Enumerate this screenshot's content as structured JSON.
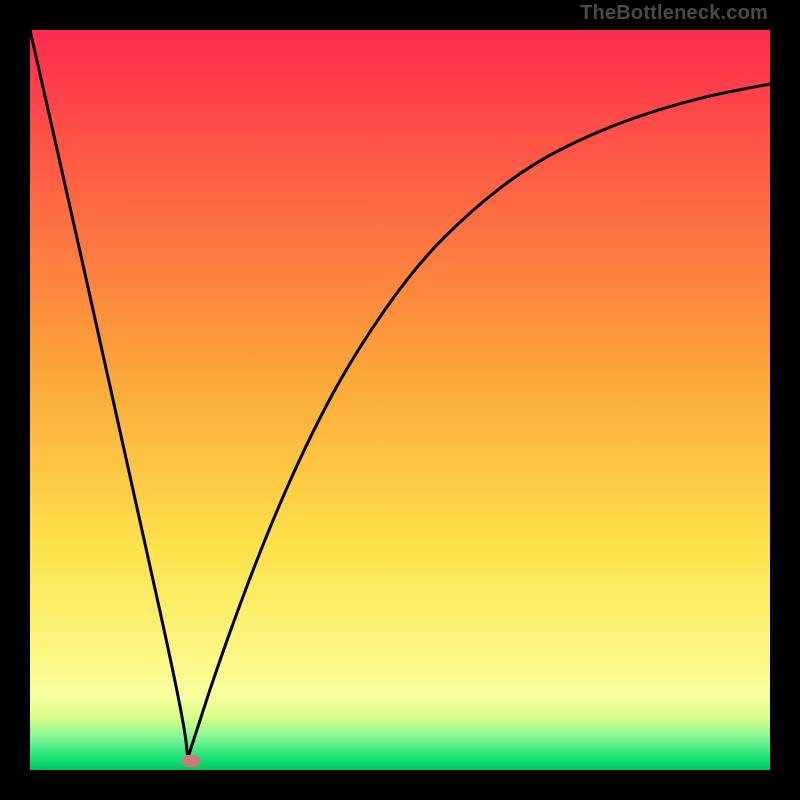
{
  "watermark": "TheBottleneck.com",
  "chart_data": {
    "type": "line",
    "title": "",
    "xlabel": "",
    "ylabel": "",
    "xlim": [
      0,
      1
    ],
    "ylim": [
      0,
      1
    ],
    "grid": false,
    "legend": false,
    "background_gradient": {
      "stops": [
        {
          "pos": 0.0,
          "color": "#ff2b4d"
        },
        {
          "pos": 0.45,
          "color": "#fca23a"
        },
        {
          "pos": 0.7,
          "color": "#fde24a"
        },
        {
          "pos": 0.86,
          "color": "#fbf98a"
        },
        {
          "pos": 0.9,
          "color": "#faffa0"
        },
        {
          "pos": 0.93,
          "color": "#d7ff87"
        },
        {
          "pos": 0.955,
          "color": "#86f798"
        },
        {
          "pos": 0.985,
          "color": "#17e072"
        },
        {
          "pos": 1.0,
          "color": "#00c561"
        }
      ]
    },
    "series": [
      {
        "name": "bottleneck-curve",
        "color": "#000000",
        "x": [
          0.0,
          0.05,
          0.1,
          0.15,
          0.19,
          0.21,
          0.213,
          0.216,
          0.26,
          0.32,
          0.38,
          0.44,
          0.52,
          0.6,
          0.68,
          0.76,
          0.84,
          0.92,
          1.0
        ],
        "y": [
          1.0,
          0.78,
          0.555,
          0.33,
          0.15,
          0.05,
          0.015,
          0.025,
          0.16,
          0.32,
          0.455,
          0.565,
          0.68,
          0.76,
          0.82,
          0.86,
          0.89,
          0.912,
          0.927
        ]
      }
    ],
    "marker": {
      "x": 0.217,
      "y": 0.012,
      "color": "#cf7a7a"
    }
  }
}
